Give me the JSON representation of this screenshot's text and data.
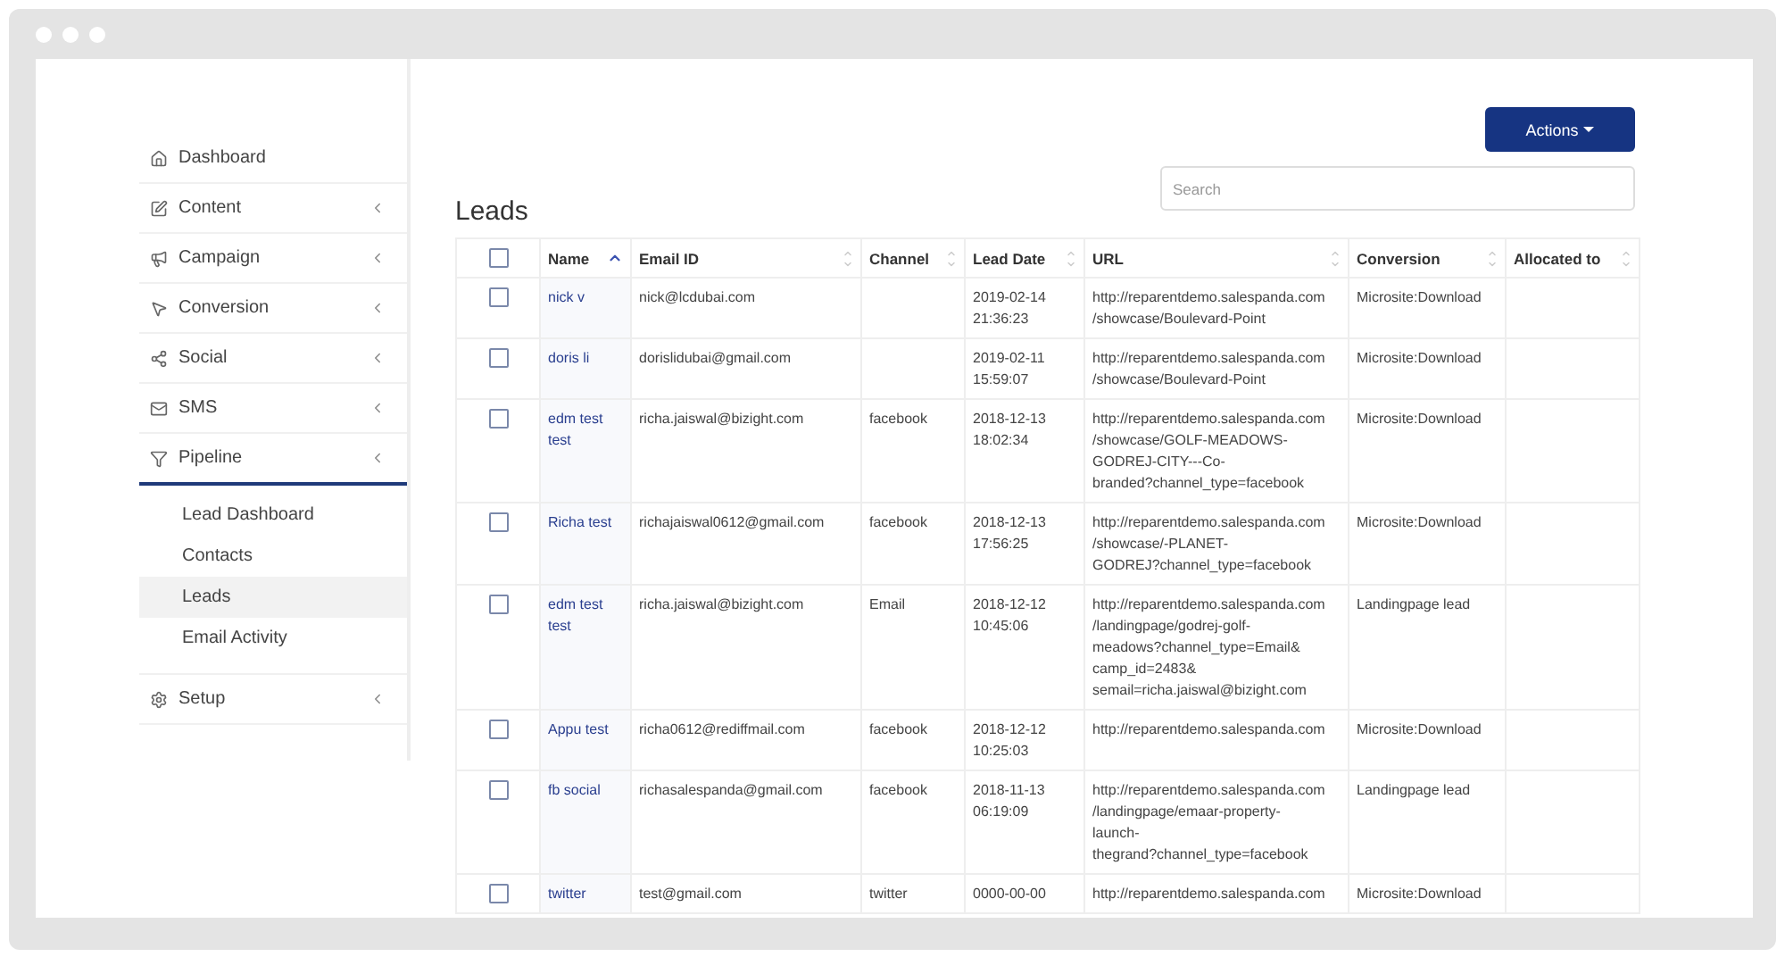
{
  "sidebar": {
    "items": [
      {
        "label": "Dashboard"
      },
      {
        "label": "Content"
      },
      {
        "label": "Campaign"
      },
      {
        "label": "Conversion"
      },
      {
        "label": "Social"
      },
      {
        "label": "SMS"
      },
      {
        "label": "Pipeline",
        "expanded": true,
        "children": [
          {
            "label": "Lead Dashboard",
            "selected": false
          },
          {
            "label": "Contacts",
            "selected": false
          },
          {
            "label": "Leads",
            "selected": true
          },
          {
            "label": "Email Activity",
            "selected": false
          }
        ]
      },
      {
        "label": "Setup"
      }
    ]
  },
  "actions_button": "Actions",
  "search": {
    "placeholder": "Search"
  },
  "title": "Leads",
  "table": {
    "select_all_checked": false,
    "columns": [
      {
        "label": "Name",
        "sorted": true
      },
      {
        "label": "Email ID",
        "sorted": false
      },
      {
        "label": "Channel",
        "sorted": false
      },
      {
        "label": "Lead Date",
        "sorted": false
      },
      {
        "label": "URL",
        "sorted": false
      },
      {
        "label": "Conversion",
        "sorted": false
      },
      {
        "label": "Allocated to",
        "sorted": false
      }
    ],
    "rows": [
      {
        "checked": false,
        "cells": [
          "nick v",
          "nick@lcdubai.com",
          "",
          "2019-02-14\n21:36:23",
          "http://reparentdemo.salespanda.com\n/showcase/Boulevard-Point",
          "Microsite:Download",
          ""
        ]
      },
      {
        "checked": false,
        "cells": [
          "doris li",
          "dorislidubai@gmail.com",
          "",
          "2019-02-11\n15:59:07",
          "http://reparentdemo.salespanda.com\n/showcase/Boulevard-Point",
          "Microsite:Download",
          ""
        ]
      },
      {
        "checked": false,
        "cells": [
          "edm test\ntest",
          "richa.jaiswal@bizight.com",
          "facebook",
          "2018-12-13\n18:02:34",
          "http://reparentdemo.salespanda.com\n/showcase/GOLF-MEADOWS-\nGODREJ-CITY---Co-\nbranded?channel_type=facebook",
          "Microsite:Download",
          ""
        ]
      },
      {
        "checked": false,
        "cells": [
          "Richa test",
          "richajaiswal0612@gmail.com",
          "facebook",
          "2018-12-13\n17:56:25",
          "http://reparentdemo.salespanda.com\n/showcase/-PLANET-\nGODREJ?channel_type=facebook",
          "Microsite:Download",
          ""
        ]
      },
      {
        "checked": false,
        "cells": [
          "edm test\ntest",
          "richa.jaiswal@bizight.com",
          "Email",
          "2018-12-12\n10:45:06",
          "http://reparentdemo.salespanda.com\n/landingpage/godrej-golf-\nmeadows?channel_type=Email&\ncamp_id=2483&\nsemail=richa.jaiswal@bizight.com",
          "Landingpage lead",
          ""
        ]
      },
      {
        "checked": false,
        "cells": [
          "Appu test",
          "richa0612@rediffmail.com",
          "facebook",
          "2018-12-12\n10:25:03",
          "http://reparentdemo.salespanda.com",
          "Microsite:Download",
          ""
        ]
      },
      {
        "checked": false,
        "cells": [
          "fb social",
          "richasalespanda@gmail.com",
          "facebook",
          "2018-11-13\n06:19:09",
          "http://reparentdemo.salespanda.com\n/landingpage/emaar-property-\nlaunch-\nthegrand?channel_type=facebook",
          "Landingpage lead",
          ""
        ]
      },
      {
        "checked": false,
        "cells": [
          "twitter",
          "test@gmail.com",
          "twitter",
          "0000-00-00",
          "http://reparentdemo.salespanda.com",
          "Microsite:Download",
          ""
        ]
      }
    ]
  }
}
